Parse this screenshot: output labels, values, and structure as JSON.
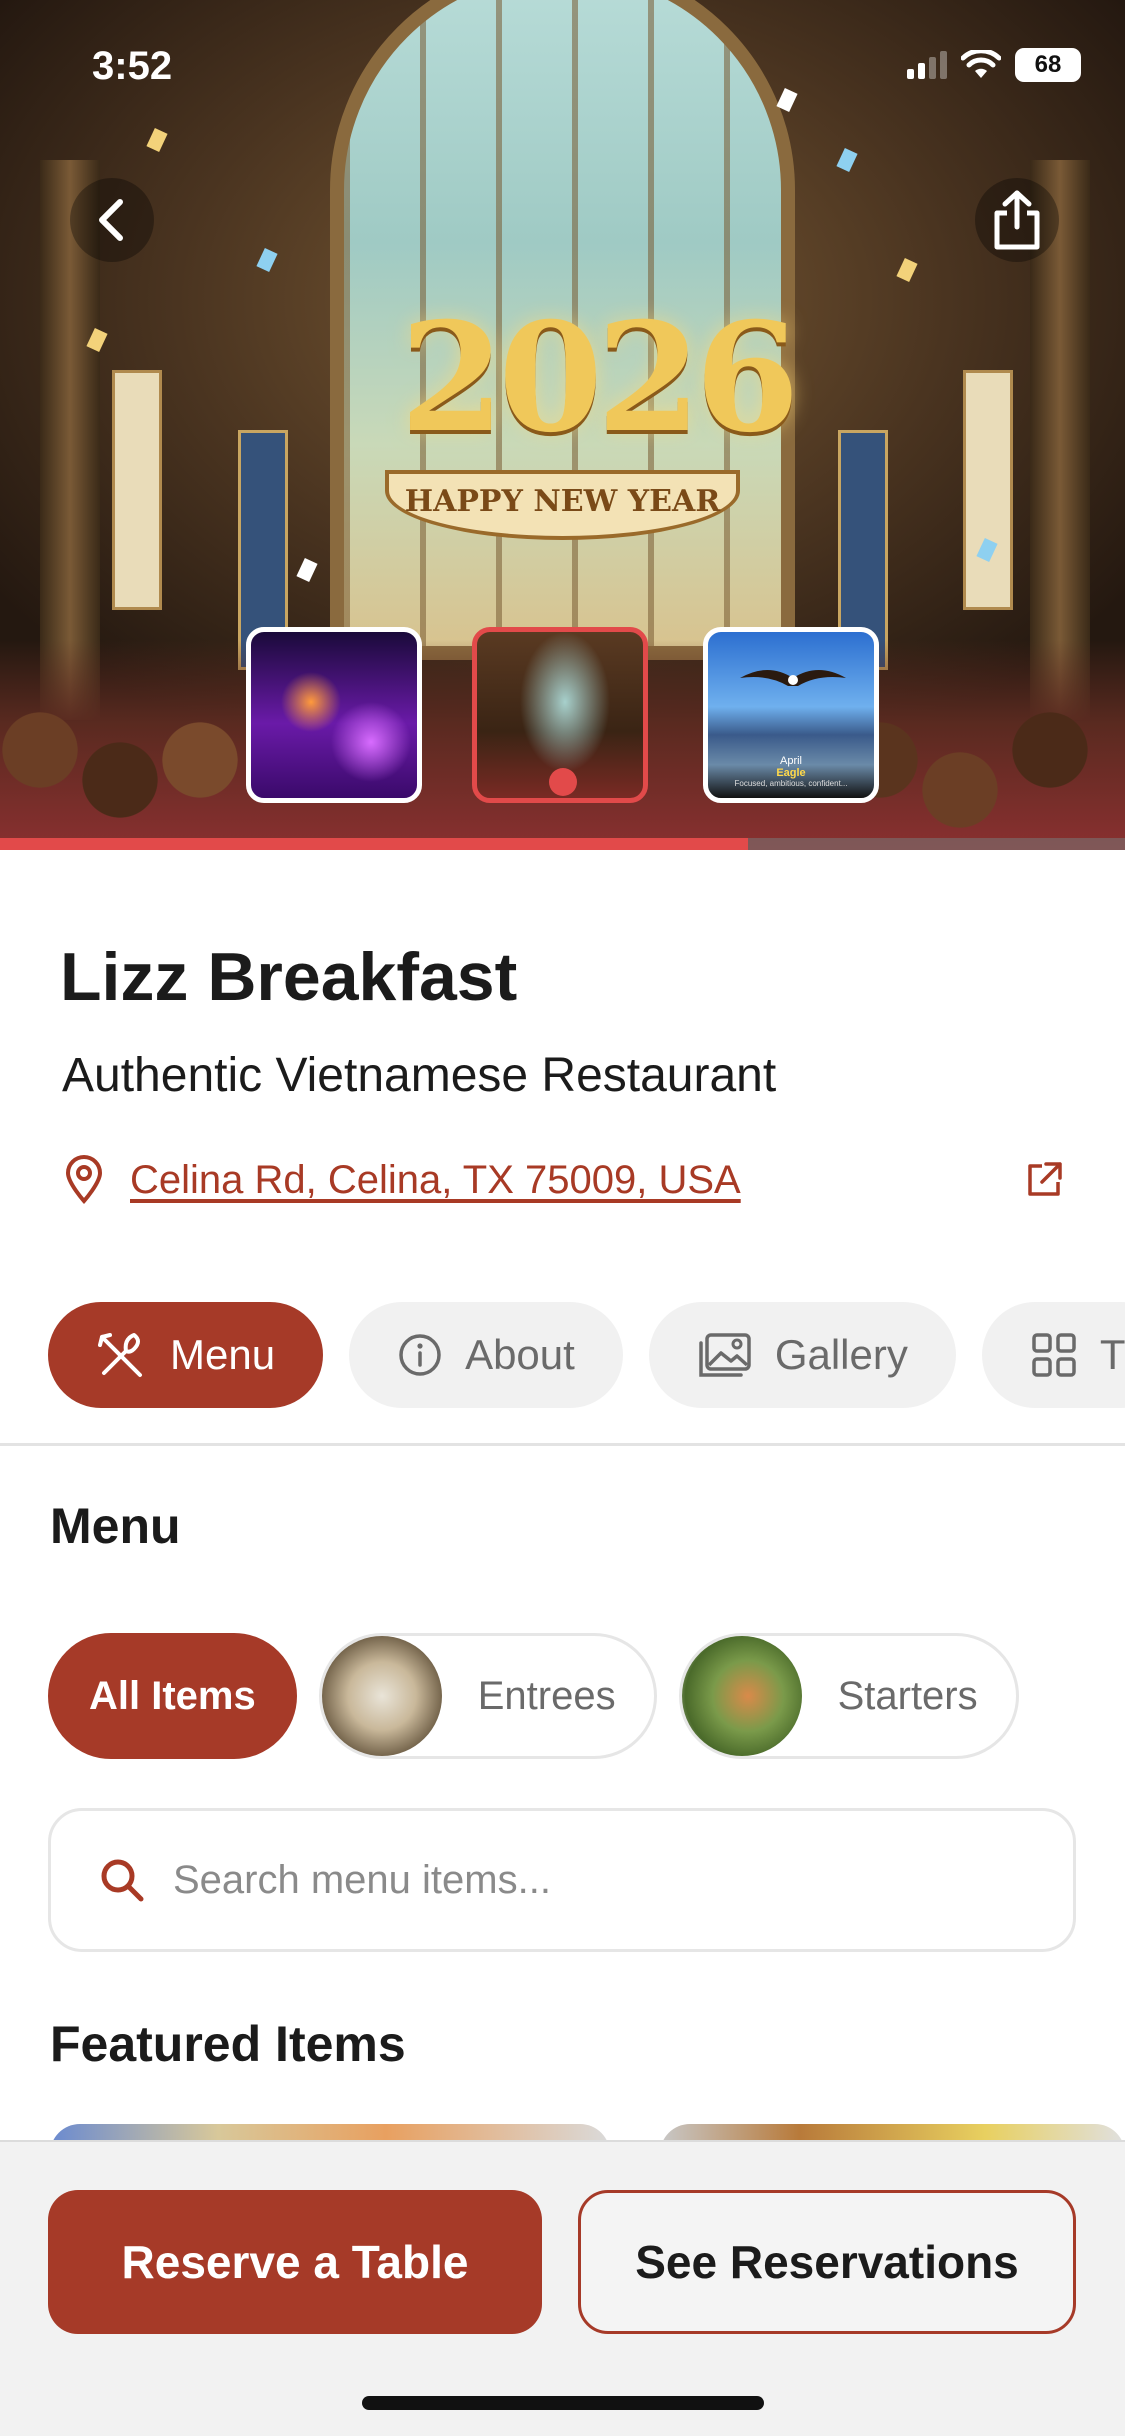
{
  "status_bar": {
    "time": "3:52",
    "battery": "68"
  },
  "hero": {
    "headline": "2026",
    "ribbon_text": "HAPPY NEW YEAR",
    "thumbnails": [
      {
        "name": "night-event-thumbnail",
        "active": false
      },
      {
        "name": "new-year-cathedral-thumbnail",
        "active": true
      },
      {
        "name": "eagle-thumbnail",
        "active": false,
        "month": "April",
        "title": "Eagle",
        "caption": "Focused, ambitious, confident..."
      }
    ],
    "progress": 0.665
  },
  "restaurant": {
    "name": "Lizz Breakfast",
    "tagline": "Authentic Vietnamese Restaurant",
    "address": "Celina Rd, Celina, TX 75009, USA"
  },
  "tabs": [
    {
      "label": "Menu",
      "icon": "utensils-icon",
      "active": true
    },
    {
      "label": "About",
      "icon": "info-icon",
      "active": false
    },
    {
      "label": "Gallery",
      "icon": "gallery-icon",
      "active": false
    },
    {
      "label": "T",
      "icon": "grid-icon",
      "active": false
    }
  ],
  "menu": {
    "heading": "Menu",
    "categories": [
      {
        "label": "All Items",
        "active": true
      },
      {
        "label": "Entrees",
        "active": false
      },
      {
        "label": "Starters",
        "active": false
      }
    ],
    "search_placeholder": "Search menu items...",
    "featured_heading": "Featured Items"
  },
  "actions": {
    "reserve_label": "Reserve a Table",
    "see_label": "See Reservations"
  },
  "colors": {
    "accent": "#a63a28",
    "progress": "#e24a4a",
    "link": "#a83a25"
  }
}
